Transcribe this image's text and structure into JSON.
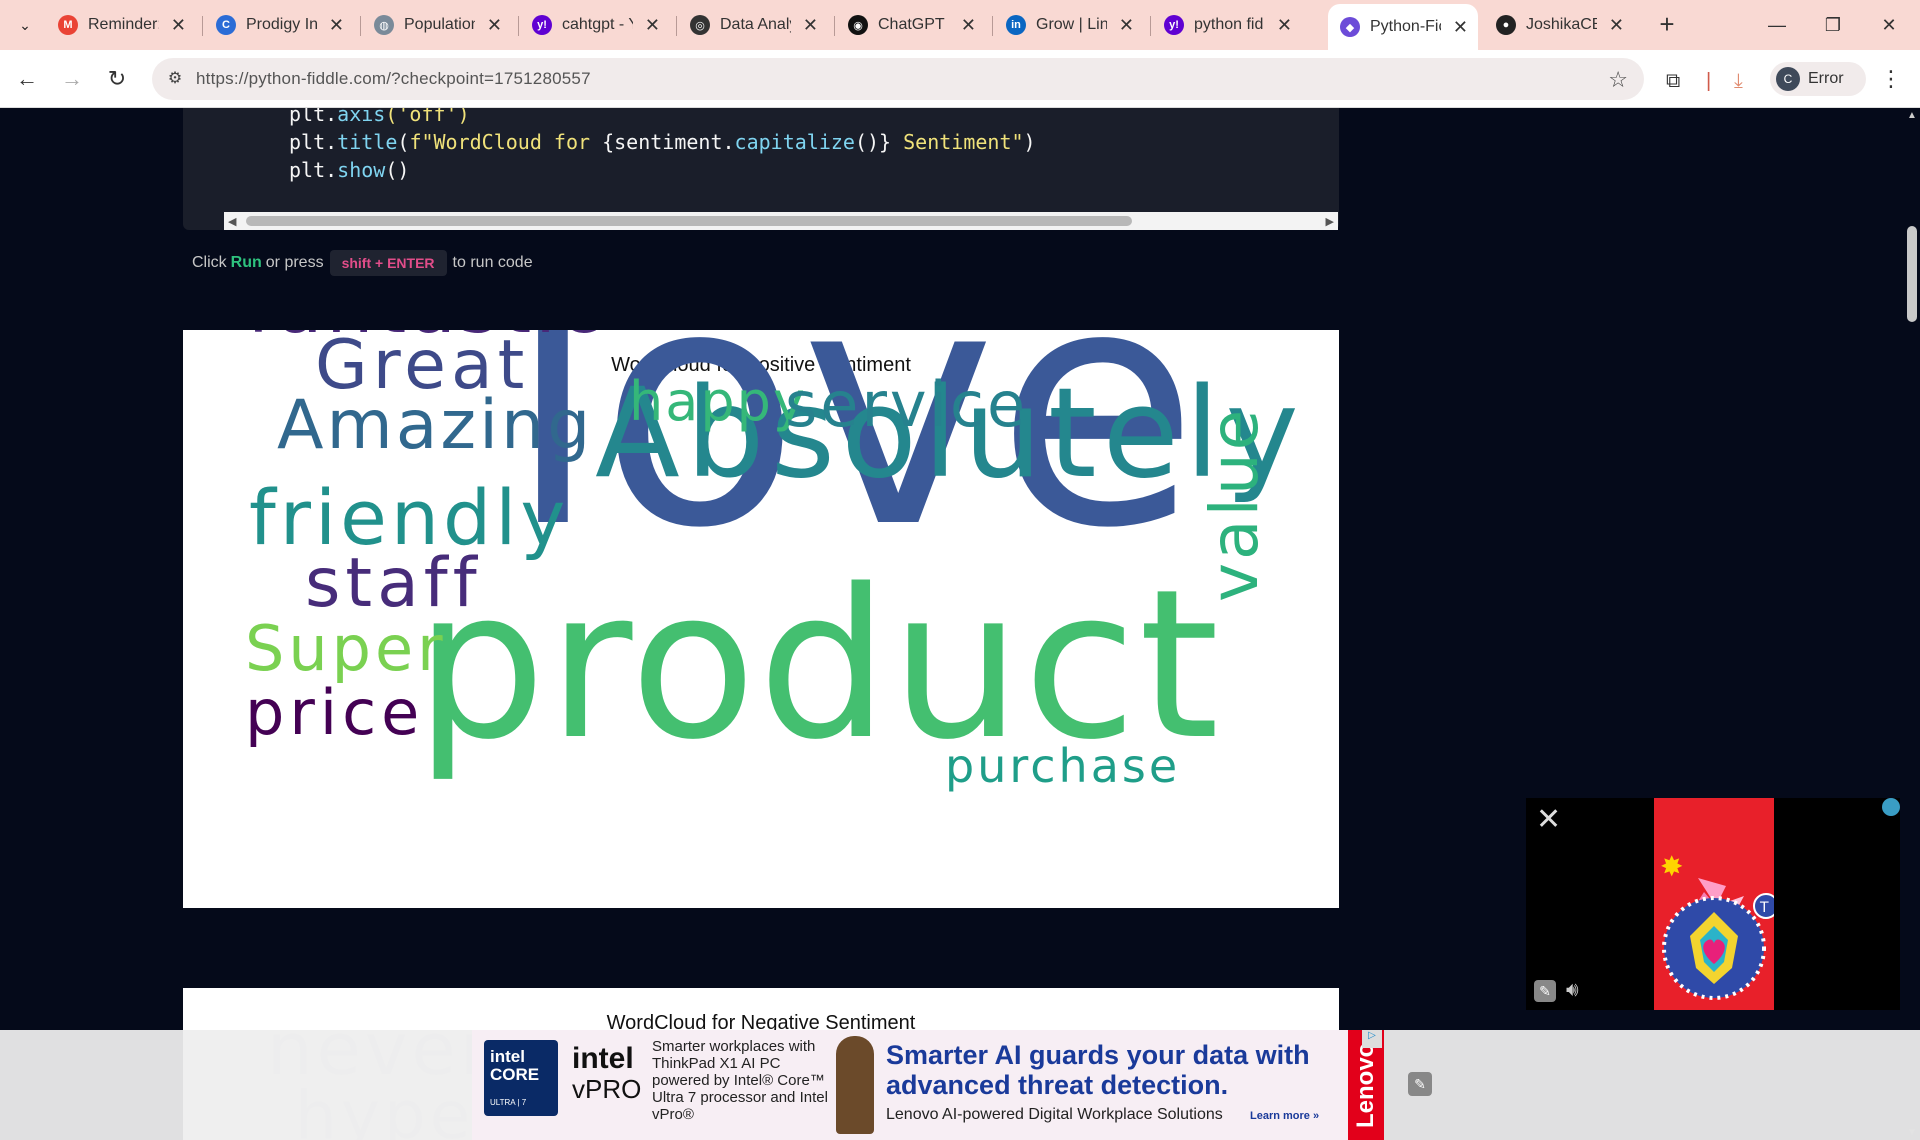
{
  "browser": {
    "tabs": [
      {
        "title": "Reminder:",
        "icon": "gmail-icon",
        "color": "#ea4335",
        "glyph": "M"
      },
      {
        "title": "Prodigy Inf",
        "icon": "prodigy-icon",
        "color": "#2b6cd6",
        "glyph": "C"
      },
      {
        "title": "Population",
        "icon": "globe-icon",
        "color": "#7a8a99",
        "glyph": "◍"
      },
      {
        "title": "cahtgpt - Y",
        "icon": "yahoo-icon",
        "color": "#6001d2",
        "glyph": "y!"
      },
      {
        "title": "Data Analy",
        "icon": "chatgpt-icon",
        "color": "#333333",
        "glyph": "◎"
      },
      {
        "title": "ChatGPT |",
        "icon": "chatgpt-icon",
        "color": "#111111",
        "glyph": "◉"
      },
      {
        "title": "Grow | Link",
        "icon": "linkedin-icon",
        "color": "#0a66c2",
        "glyph": "in"
      },
      {
        "title": "python fid",
        "icon": "yahoo-icon",
        "color": "#6001d2",
        "glyph": "y!"
      },
      {
        "title": "Python-Fic",
        "icon": "pythonfiddle-icon",
        "color": "#6c4bd8",
        "glyph": "◆",
        "active": true
      },
      {
        "title": "JoshikaCB",
        "icon": "github-icon",
        "color": "#222222",
        "glyph": "●"
      }
    ],
    "url": "https://python-fiddle.com/?checkpoint=1751280557",
    "profile_label": "Error",
    "profile_initial": "C"
  },
  "code": {
    "line1_obj": "plt.",
    "line1_fn": "axis",
    "line1_arg": "('off')",
    "line2_obj": "plt.",
    "line2_fn": "title",
    "line2_open": "(",
    "line2_str1": "f\"WordCloud for ",
    "line2_expr1": "{sentiment.",
    "line2_expr_fn": "capitalize",
    "line2_expr2": "()}",
    "line2_str2": " Sentiment\"",
    "line2_close": ")",
    "line3_obj": "plt.",
    "line3_fn": "show",
    "line3_arg": "()"
  },
  "hint": {
    "prefix": "Click",
    "run": "Run",
    "mid": "or press",
    "shortcut": "shift + ENTER",
    "suffix": "to run code"
  },
  "plots": {
    "positive_title": "WordCloud for Positive Sentiment",
    "negative_title": "WordCloud for Negative Sentiment",
    "positive_words": [
      {
        "text": "love",
        "color": "#3b5998"
      },
      {
        "text": "product",
        "color": "#44bf70"
      },
      {
        "text": "Absolutely",
        "color": "#24878e"
      },
      {
        "text": "fantastic",
        "color": "#482878"
      },
      {
        "text": "Great",
        "color": "#3e4a89"
      },
      {
        "text": "Amazing",
        "color": "#31688e"
      },
      {
        "text": "happy",
        "color": "#35b779"
      },
      {
        "text": "service",
        "color": "#26828e"
      },
      {
        "text": "friendly",
        "color": "#21918c"
      },
      {
        "text": "staff",
        "color": "#472c7a"
      },
      {
        "text": "value",
        "color": "#2db27d"
      },
      {
        "text": "Super",
        "color": "#7ad151"
      },
      {
        "text": "price",
        "color": "#440154"
      },
      {
        "text": "purchase",
        "color": "#1f9e89"
      }
    ],
    "negative_words": [
      {
        "text": "never",
        "color": "#dcdfe6"
      },
      {
        "text": "hype",
        "color": "#dcdfe6"
      }
    ]
  },
  "ads": {
    "core_label": "intel CORE",
    "core_sub": "ULTRA | 7",
    "vpro_brand": "intel",
    "vpro_name": "vPRO",
    "small_text": "Smarter workplaces with ThinkPad X1 AI PC powered by Intel® Core™ Ultra 7 processor and Intel vPro®",
    "headline": "Smarter AI guards your data with advanced threat detection.",
    "sub": "Lenovo AI-powered Digital Workplace Solutions",
    "learn": "Learn more »",
    "brand": "Lenovo"
  }
}
